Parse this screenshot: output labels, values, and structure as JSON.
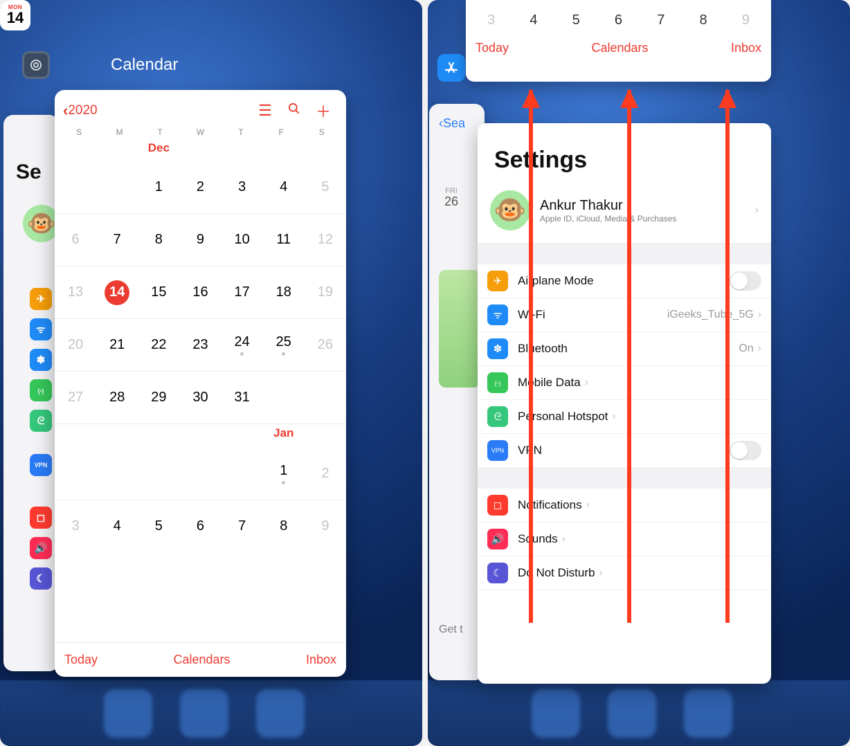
{
  "left": {
    "app_label": "Calendar",
    "icon_mon": "MON",
    "icon_day": "14",
    "back_year": "2020",
    "dow": [
      "S",
      "M",
      "T",
      "W",
      "T",
      "F",
      "S"
    ],
    "month1": "Dec",
    "month2": "Jan",
    "weeks_dec": [
      [
        "",
        "",
        "1",
        "2",
        "3",
        "4",
        "5"
      ],
      [
        "6",
        "7",
        "8",
        "9",
        "10",
        "11",
        "12"
      ],
      [
        "13",
        "14",
        "15",
        "16",
        "17",
        "18",
        "19"
      ],
      [
        "20",
        "21",
        "22",
        "23",
        "24",
        "25",
        "26"
      ],
      [
        "27",
        "28",
        "29",
        "30",
        "31",
        "",
        ""
      ]
    ],
    "dec_dots": [
      "24",
      "25"
    ],
    "today_day": "14",
    "jan_row1": [
      "",
      "",
      "",
      "",
      "",
      "1",
      "2"
    ],
    "jan_dots": [
      "1"
    ],
    "jan_row2": [
      "3",
      "4",
      "5",
      "6",
      "7",
      "8",
      "9"
    ],
    "bottom": {
      "today": "Today",
      "calendars": "Calendars",
      "inbox": "Inbox"
    },
    "bg_settings_label": "Se",
    "bg_icons": [
      {
        "color": "orange",
        "glyph": "✈"
      },
      {
        "color": "blue",
        "glyph": "ᯤ"
      },
      {
        "color": "blue",
        "glyph": "✽"
      },
      {
        "color": "green",
        "glyph": "(ꞏ)"
      },
      {
        "color": "teal",
        "glyph": "ᘓ"
      },
      {
        "color": "bluef",
        "glyph": "VPN"
      },
      {
        "color": "red",
        "glyph": "◻"
      },
      {
        "color": "pink",
        "glyph": "🔊"
      },
      {
        "color": "purple",
        "glyph": "☾"
      }
    ]
  },
  "right": {
    "top_nums": [
      "3",
      "4",
      "5",
      "6",
      "7",
      "8",
      "9"
    ],
    "top_bottom": {
      "today": "Today",
      "calendars": "Calendars",
      "inbox": "Inbox"
    },
    "back_label": "Sea",
    "date_small": {
      "d1": "FRI",
      "d2": "26"
    },
    "get_prefix": "Get t",
    "settings_title": "Settings",
    "account": {
      "name": "Ankur Thakur",
      "sub": "Apple ID, iCloud, Media & Purchases"
    },
    "rows_g1": [
      {
        "icon": "✈",
        "color": "orange",
        "label": "Airplane Mode",
        "value": "",
        "type": "toggle"
      },
      {
        "icon": "ᯤ",
        "color": "blue",
        "label": "Wi-Fi",
        "value": "iGeeks_Tube_5G",
        "type": "chev"
      },
      {
        "icon": "✽",
        "color": "blue",
        "label": "Bluetooth",
        "value": "On",
        "type": "chev"
      },
      {
        "icon": "(ꞏ)",
        "color": "green",
        "label": "Mobile Data",
        "value": "",
        "type": "chev"
      },
      {
        "icon": "ᘓ",
        "color": "teal",
        "label": "Personal Hotspot",
        "value": "",
        "type": "chev"
      },
      {
        "icon": "VPN",
        "color": "bluef",
        "label": "VPN",
        "value": "",
        "type": "toggle"
      }
    ],
    "rows_g2": [
      {
        "icon": "◻",
        "color": "red",
        "label": "Notifications",
        "value": "",
        "type": "chev"
      },
      {
        "icon": "🔊",
        "color": "pink",
        "label": "Sounds",
        "value": "",
        "type": "chev"
      },
      {
        "icon": "☾",
        "color": "purple",
        "label": "Do Not Disturb",
        "value": "",
        "type": "chev"
      }
    ]
  }
}
